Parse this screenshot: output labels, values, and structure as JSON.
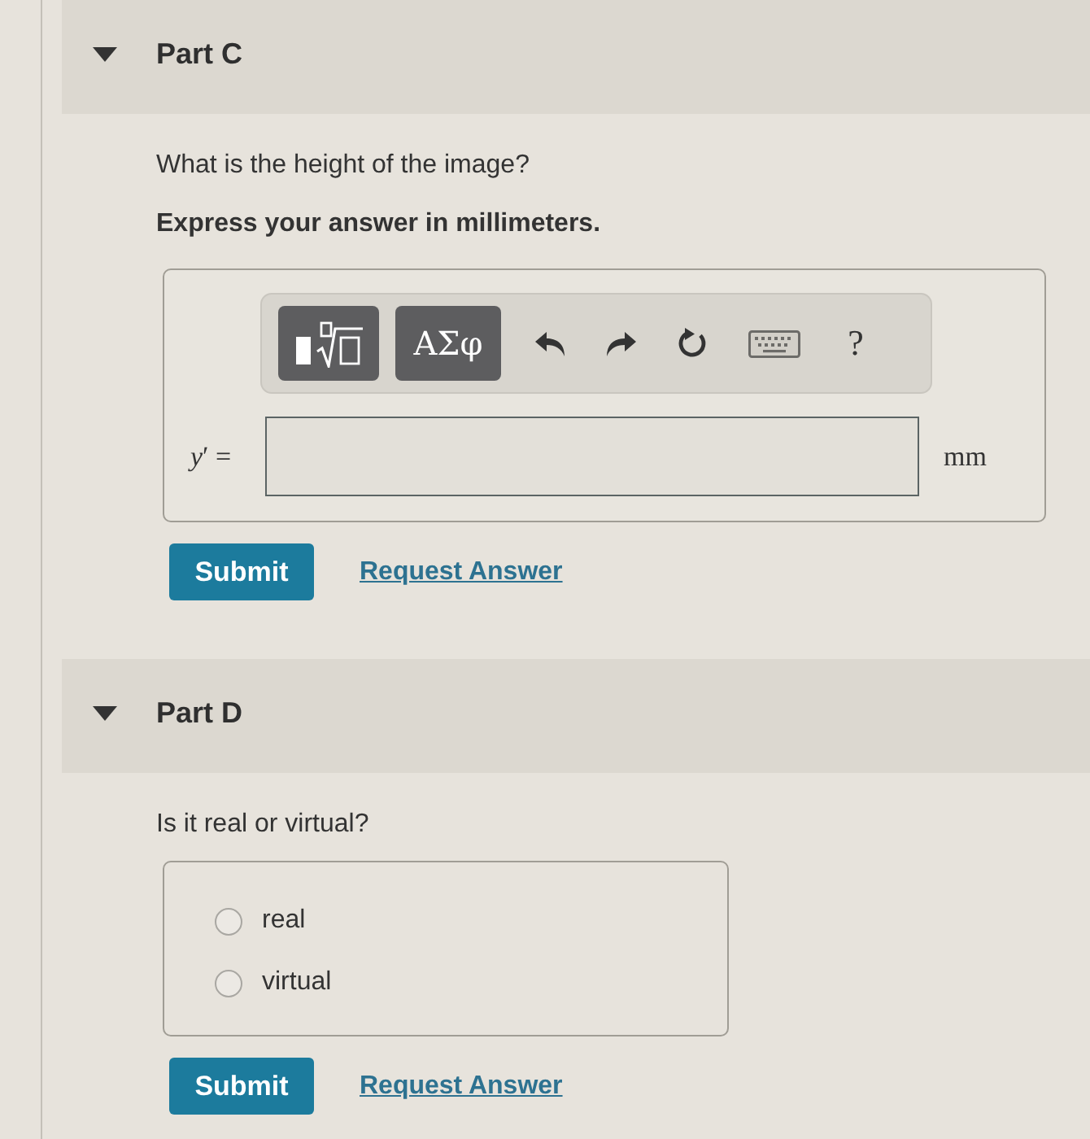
{
  "parts": [
    {
      "title": "Part C",
      "expanded": true,
      "question": "What is the height of the image?",
      "instruction": "Express your answer in millimeters.",
      "answer": {
        "kind": "math",
        "toolbar": [
          {
            "kind": "templates"
          },
          {
            "kind": "symbols",
            "label": "ΑΣφ"
          },
          {
            "kind": "undo"
          },
          {
            "kind": "redo"
          },
          {
            "kind": "reset"
          },
          {
            "kind": "keyboard"
          },
          {
            "kind": "help",
            "label": "?"
          }
        ],
        "variable": "*y*′ =",
        "unit": "mm"
      },
      "actions": {
        "submit": "Submit",
        "request": "Request Answer"
      }
    },
    {
      "title": "Part D",
      "expanded": true,
      "question": "Is it real or virtual?",
      "answer": {
        "kind": "choice",
        "options": [
          {
            "label": "real",
            "selected": false
          },
          {
            "label": "virtual",
            "selected": false
          }
        ]
      },
      "actions": {
        "submit": "Submit",
        "request": "Request Answer"
      }
    }
  ]
}
